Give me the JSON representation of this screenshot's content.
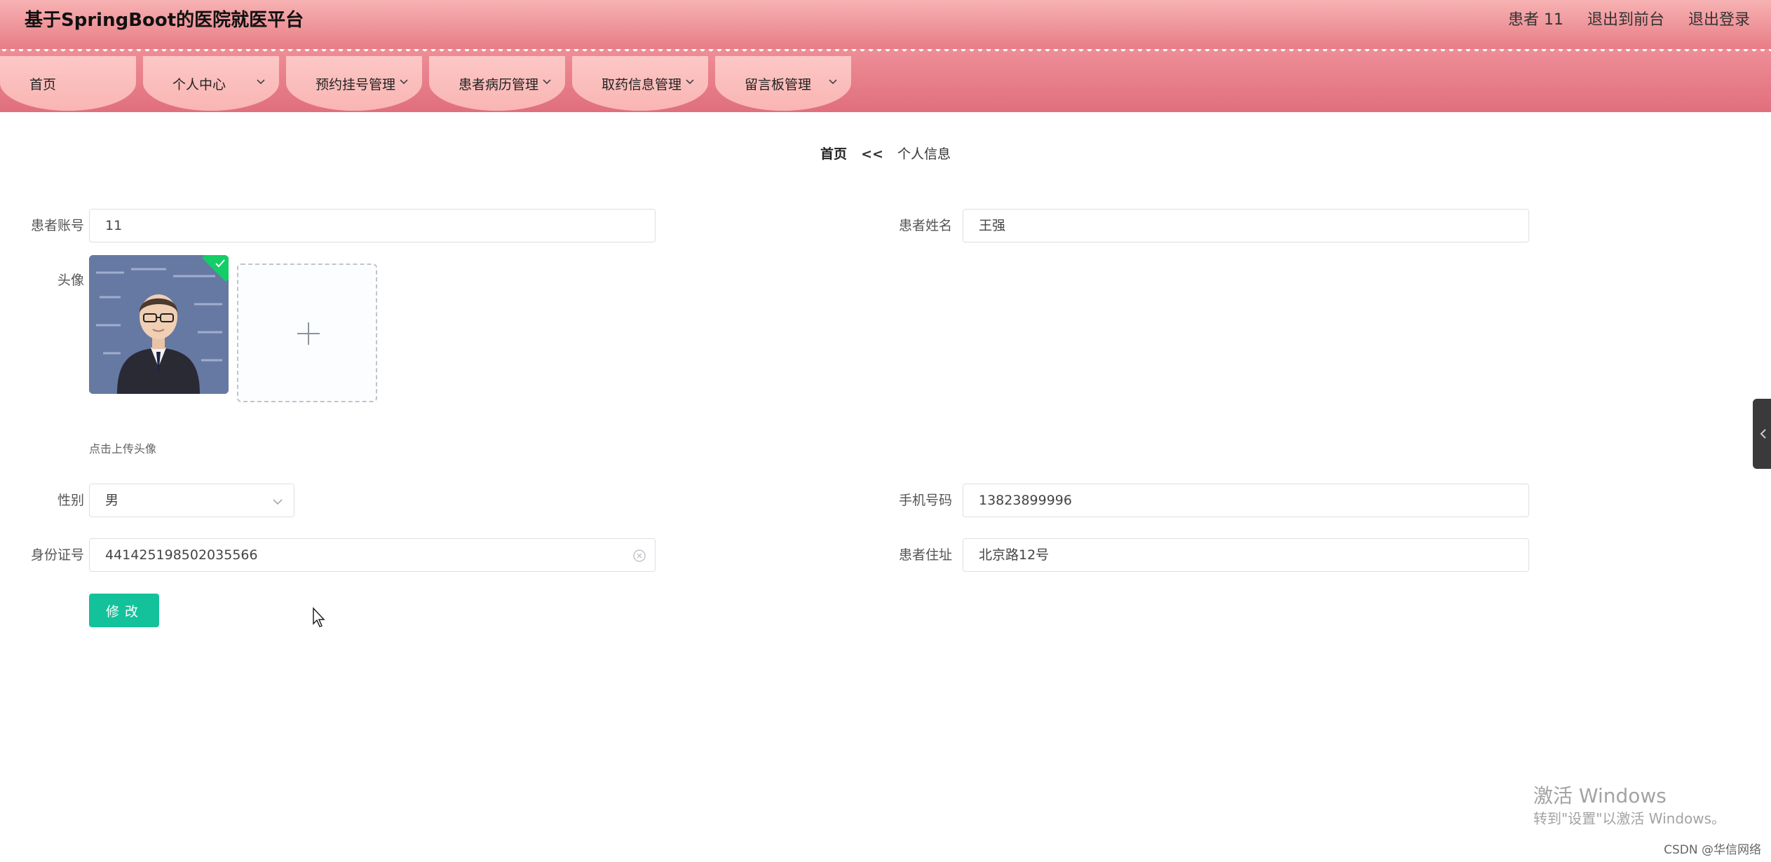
{
  "header": {
    "title": "基于SpringBoot的医院就医平台",
    "user_label": "患者 11",
    "back_to_front": "退出到前台",
    "logout": "退出登录"
  },
  "nav": {
    "items": [
      {
        "label": "首页",
        "has_dropdown": false
      },
      {
        "label": "个人中心",
        "has_dropdown": true
      },
      {
        "label": "预约挂号管理",
        "has_dropdown": true
      },
      {
        "label": "患者病历管理",
        "has_dropdown": true
      },
      {
        "label": "取药信息管理",
        "has_dropdown": true
      },
      {
        "label": "留言板管理",
        "has_dropdown": true
      }
    ]
  },
  "breadcrumb": {
    "home": "首页",
    "separator": "<<",
    "current": "个人信息"
  },
  "form": {
    "account_label": "患者账号",
    "account_value": "11",
    "name_label": "患者姓名",
    "name_value": "王强",
    "avatar_label": "头像",
    "upload_tip": "点击上传头像",
    "gender_label": "性别",
    "gender_value": "男",
    "phone_label": "手机号码",
    "phone_value": "13823899996",
    "id_label": "身份证号",
    "id_value": "441425198502035566",
    "address_label": "患者住址",
    "address_value": "北京路12号",
    "submit_label": "修改"
  },
  "overlay": {
    "watermark_line1": "激活 Windows",
    "watermark_line2": "转到\"设置\"以激活 Windows。",
    "csdn": "CSDN @华信网络"
  },
  "colors": {
    "header_gradient_top": "#f7b2b2",
    "header_gradient_bottom": "#e77b85",
    "nav_item": "#fcc7c5",
    "submit_button": "#13c29a",
    "upload_success": "#13ce66"
  },
  "icons": {
    "nav_dropdown": "chevron-down-icon",
    "upload": "plus-icon",
    "clear": "circle-close-icon",
    "select": "chevron-down-icon",
    "side_tab": "chevron-left-icon",
    "upload_done": "check-icon"
  }
}
